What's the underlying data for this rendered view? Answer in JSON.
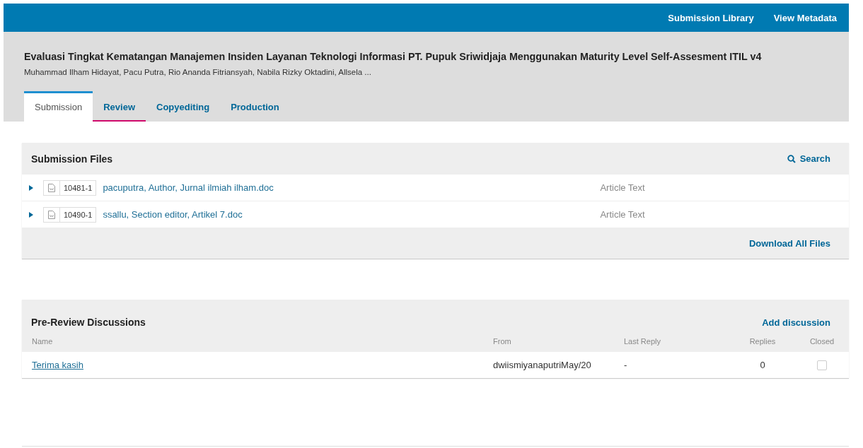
{
  "top_bar": {
    "links": [
      "Submission Library",
      "View Metadata"
    ]
  },
  "submission": {
    "title": "Evaluasi Tingkat Kematangan Manajemen Insiden Layanan Teknologi Informasi PT. Pupuk Sriwidjaja Menggunakan Maturity Level Self-Assesment ITIL v4",
    "authors": "Muhammad Ilham Hidayat, Pacu Putra, Rio Ananda Fitriansyah, Nabila Rizky Oktadini, Allsela ..."
  },
  "tabs": [
    {
      "label": "Submission",
      "selected": true,
      "underlined": false
    },
    {
      "label": "Review",
      "selected": false,
      "underlined": true
    },
    {
      "label": "Copyediting",
      "selected": false,
      "underlined": false
    },
    {
      "label": "Production",
      "selected": false,
      "underlined": false
    }
  ],
  "submission_files": {
    "title": "Submission Files",
    "search": "Search",
    "files": [
      {
        "id": "10481-1",
        "name": "pacuputra, Author, Jurnal ilmiah ilham.doc",
        "type": "Article Text"
      },
      {
        "id": "10490-1",
        "name": "ssallu, Section editor, Artikel 7.doc",
        "type": "Article Text"
      }
    ],
    "download_all": "Download All Files"
  },
  "discussions": {
    "title": "Pre-Review Discussions",
    "add": "Add discussion",
    "columns": [
      "Name",
      "From",
      "Last Reply",
      "Replies",
      "Closed"
    ],
    "rows": [
      {
        "name": "Terima kasih",
        "from": "dwiismiyanaputriMay/20",
        "last_reply": "-",
        "replies": "0",
        "closed": false
      }
    ]
  }
}
